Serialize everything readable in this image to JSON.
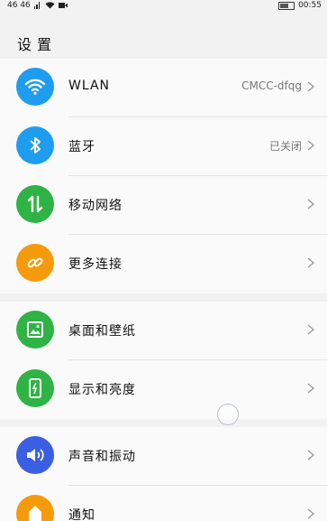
{
  "status_bar": {
    "left_text": "46 46",
    "time": "00:55"
  },
  "page": {
    "title": "设置"
  },
  "groups": [
    {
      "items": [
        {
          "label": "WLAN",
          "value": "CMCC-dfqg",
          "icon": "wifi-icon",
          "color": "#1e9cf0"
        },
        {
          "label": "蓝牙",
          "value": "已关闭",
          "icon": "bluetooth-icon",
          "color": "#1e9cf0"
        },
        {
          "label": "移动网络",
          "value": "",
          "icon": "mobile-network-icon",
          "color": "#2fb344"
        },
        {
          "label": "更多连接",
          "value": "",
          "icon": "link-icon",
          "color": "#f59b0b"
        }
      ]
    },
    {
      "items": [
        {
          "label": "桌面和壁纸",
          "value": "",
          "icon": "wallpaper-icon",
          "color": "#2fb344"
        },
        {
          "label": "显示和亮度",
          "value": "",
          "icon": "display-brightness-icon",
          "color": "#2fb344"
        }
      ]
    },
    {
      "items": [
        {
          "label": "声音和振动",
          "value": "",
          "icon": "sound-icon",
          "color": "#3a5fe0"
        },
        {
          "label": "通知",
          "value": "",
          "icon": "notification-icon",
          "color": "#f59b0b"
        }
      ]
    }
  ]
}
